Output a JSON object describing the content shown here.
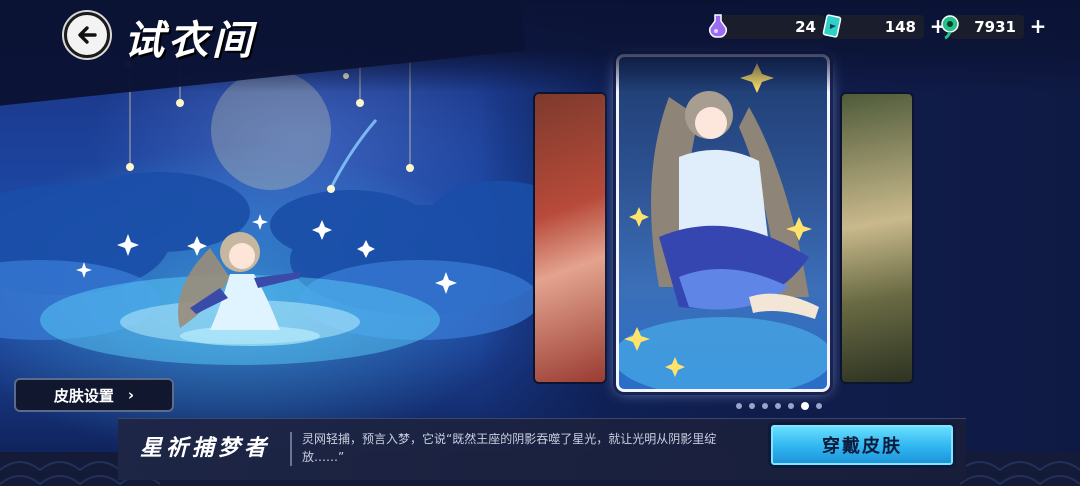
{
  "header": {
    "title": "试衣间",
    "back_icon": "arrow-left-icon"
  },
  "currencies": [
    {
      "icon": "potion-icon",
      "value": "24",
      "has_plus": false,
      "color": "#9a6cf0"
    },
    {
      "icon": "ticket-icon",
      "value": "148",
      "has_plus": true,
      "color": "#2fd0c8"
    },
    {
      "icon": "jade-drop-icon",
      "value": "7931",
      "has_plus": true,
      "color": "#27c08a"
    }
  ],
  "left_panel": {
    "skin_settings_label": "皮肤设置",
    "skin_settings_chevron": "›"
  },
  "carousel": {
    "dots": 7,
    "active_index": 5
  },
  "info": {
    "skin_name": "星祈捕梦者",
    "description": "灵网轻捕，预言入梦，它说“既然王座的阴影吞噬了星光，就让光明从阴影里绽放……”",
    "wear_button": "穿戴皮肤"
  },
  "colors": {
    "accent_button": "#2fb5f0",
    "panel": "#1a2140",
    "background": "#1d4aa8"
  }
}
